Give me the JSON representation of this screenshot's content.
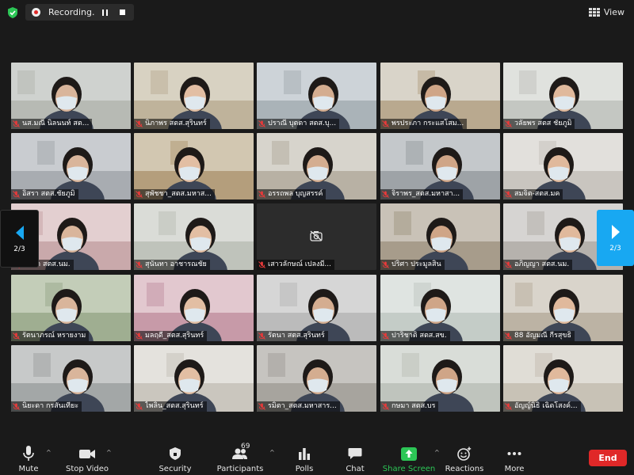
{
  "colors": {
    "background": "#1a1a1a",
    "share_green": "#2cc656",
    "end_red": "#e02828",
    "page_next": "#18a8f2"
  },
  "topbar": {
    "recording_label": "Recording...",
    "view_label": "View",
    "icons": [
      "shield-check-icon",
      "record-icon",
      "pause-icon",
      "stop-icon",
      "grid-view-icon"
    ]
  },
  "pager": {
    "left_label": "2/3",
    "right_label": "2/3"
  },
  "participants": [
    {
      "name": "นส.มณี นิลนนท์ สต...",
      "camera": "on",
      "muted": true
    },
    {
      "name": "นิภาพร สตส.สุรินทร์",
      "camera": "on",
      "muted": true
    },
    {
      "name": "ปราณี บุตตา สตส.บุ...",
      "camera": "on",
      "muted": true
    },
    {
      "name": "พรประภา กระแสโสม...",
      "camera": "on",
      "muted": true
    },
    {
      "name": "วลัยพร สตส ชัยภูมิ",
      "camera": "on",
      "muted": true
    },
    {
      "name": "อิสรา สตส.ชัยภูมิ",
      "camera": "on",
      "muted": true
    },
    {
      "name": "สุพัชชา_สตส.มหาส...",
      "camera": "on",
      "muted": true
    },
    {
      "name": "อรรถพล บุญสรรค์",
      "camera": "on",
      "muted": true
    },
    {
      "name": "จิราพร_สตส.มหาสา...",
      "camera": "on",
      "muted": true
    },
    {
      "name": "สมจิต-สตส.มค",
      "camera": "on",
      "muted": true
    },
    {
      "name": "ชนิดา สตส.นม.",
      "camera": "on",
      "muted": true
    },
    {
      "name": "สุนันทา อาชารณชัย",
      "camera": "on",
      "muted": true
    },
    {
      "name": "เสาวลักษณ์ เปลงมี...",
      "camera": "off",
      "muted": true
    },
    {
      "name": "ปริศา ประมูลสิน",
      "camera": "on",
      "muted": true
    },
    {
      "name": "อภิญญา สตส.นม.",
      "camera": "on",
      "muted": true
    },
    {
      "name": "รัตนาภรณ์ หรายงาม",
      "camera": "on",
      "muted": true
    },
    {
      "name": "มลฤดี_สตส.สุรินทร์",
      "camera": "on",
      "muted": true
    },
    {
      "name": "รัตนา สตส.สุรินทร์",
      "camera": "on",
      "muted": true
    },
    {
      "name": "ปาริชาติ สตส.สข.",
      "camera": "on",
      "muted": true
    },
    {
      "name": "88 อัญมณี กีรสุขธิ",
      "camera": "on",
      "muted": true
    },
    {
      "name": "นิยะดา กรสันเทียะ",
      "camera": "on",
      "muted": true
    },
    {
      "name": "ไพลิน_สตส.สุรินทร์",
      "camera": "on",
      "muted": true
    },
    {
      "name": "รมิตา_สตส.มหาสาร...",
      "camera": "on",
      "muted": true
    },
    {
      "name": "กษมา สตส.บร",
      "camera": "on",
      "muted": true
    },
    {
      "name": "อัญญ์นิธิ เฉิดโสงค์...",
      "camera": "on",
      "muted": true
    }
  ],
  "toolbar": {
    "mute_label": "Mute",
    "video_label": "Stop Video",
    "security_label": "Security",
    "participants_label": "Participants",
    "participants_count": "69",
    "polls_label": "Polls",
    "chat_label": "Chat",
    "share_label": "Share Screen",
    "reactions_label": "Reactions",
    "more_label": "More",
    "end_label": "End",
    "icons": [
      "microphone-icon",
      "video-camera-icon",
      "shield-icon",
      "people-icon",
      "polls-icon",
      "chat-icon",
      "share-screen-icon",
      "reactions-icon",
      "more-icon"
    ]
  }
}
